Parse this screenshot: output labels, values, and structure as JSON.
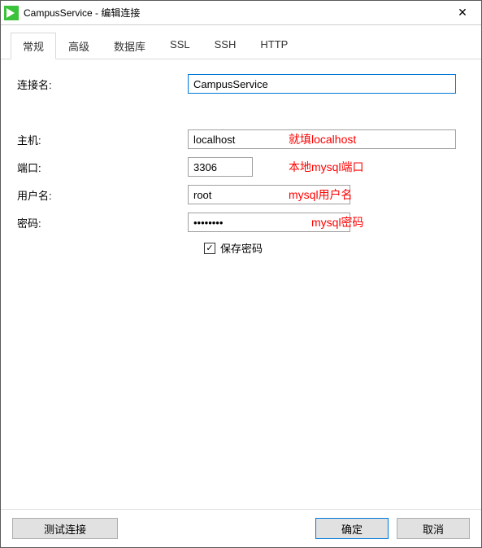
{
  "window": {
    "title": "CampusService - 编辑连接"
  },
  "tabs": [
    {
      "label": "常规",
      "active": true
    },
    {
      "label": "高级",
      "active": false
    },
    {
      "label": "数据库",
      "active": false
    },
    {
      "label": "SSL",
      "active": false
    },
    {
      "label": "SSH",
      "active": false
    },
    {
      "label": "HTTP",
      "active": false
    }
  ],
  "form": {
    "connection_name_label": "连接名:",
    "connection_name_value": "CampusService",
    "host_label": "主机:",
    "host_value": "localhost",
    "port_label": "端口:",
    "port_value": "3306",
    "user_label": "用户名:",
    "user_value": "root",
    "password_label": "密码:",
    "password_value": "••••••••",
    "save_password_label": "保存密码",
    "save_password_checked": true
  },
  "annotations": {
    "host": "就填localhost",
    "port": "本地mysql端口",
    "user": "mysql用户名",
    "password": "mysql密码"
  },
  "buttons": {
    "test": "测试连接",
    "ok": "确定",
    "cancel": "取消"
  }
}
